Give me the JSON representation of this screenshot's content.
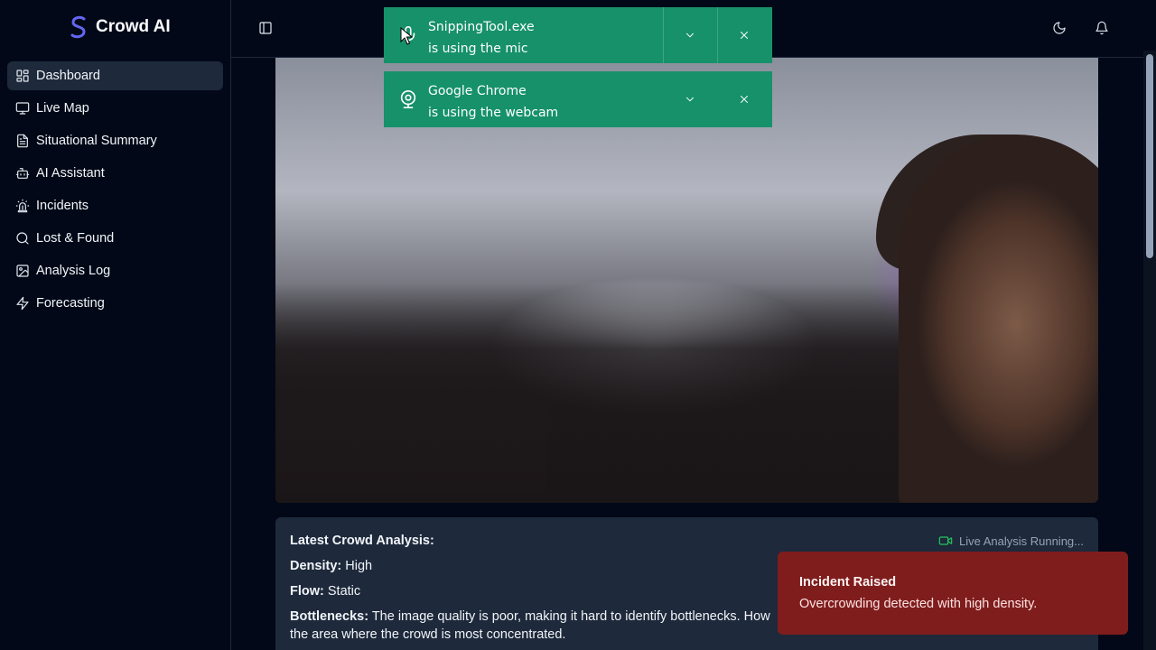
{
  "brand": {
    "name": "Crowd AI",
    "logo_letter": "S",
    "logo_color": "#6366f1"
  },
  "sidebar": {
    "items": [
      {
        "label": "Dashboard",
        "icon": "layout-grid-icon",
        "active": true
      },
      {
        "label": "Live Map",
        "icon": "monitor-icon",
        "active": false
      },
      {
        "label": "Situational Summary",
        "icon": "file-text-icon",
        "active": false
      },
      {
        "label": "AI Assistant",
        "icon": "bot-icon",
        "active": false
      },
      {
        "label": "Incidents",
        "icon": "siren-icon",
        "active": false
      },
      {
        "label": "Lost & Found",
        "icon": "search-icon",
        "active": false
      },
      {
        "label": "Analysis Log",
        "icon": "image-file-icon",
        "active": false
      },
      {
        "label": "Forecasting",
        "icon": "zap-icon",
        "active": false
      }
    ]
  },
  "header": {
    "toggle_icon": "panel-left-icon",
    "theme_icon": "moon-icon",
    "notifications_icon": "bell-icon"
  },
  "analysis": {
    "heading": "Latest Crowd Analysis:",
    "status": "Live Analysis Running...",
    "density_label": "Density:",
    "density_value": "High",
    "flow_label": "Flow:",
    "flow_value": "Static",
    "bottlenecks_label": "Bottlenecks:",
    "bottlenecks_value": "The image quality is poor, making it hard to identify bottlenecks. How",
    "bottlenecks_cont": "the area where the crowd is most concentrated."
  },
  "notifications": [
    {
      "app": "SnippingTool.exe",
      "message": "is using the mic",
      "icon": "microphone-icon"
    },
    {
      "app": "Google Chrome",
      "message": "is using the webcam",
      "icon": "webcam-icon"
    }
  ],
  "toast": {
    "title": "Incident Raised",
    "message": "Overcrowding detected with high density.",
    "color": "#7f1d1d"
  },
  "colors": {
    "background": "#020817",
    "panel": "#1e293b",
    "notification": "#16916a",
    "live_indicator": "#22c55e"
  }
}
